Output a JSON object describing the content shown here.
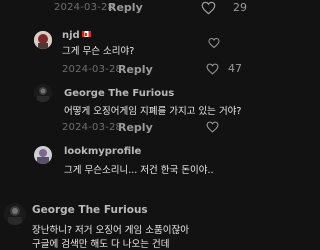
{
  "top_comment": {
    "date": "2024-03-28",
    "reply_label": "Reply",
    "like_count": "29"
  },
  "replies": [
    {
      "username": "njd",
      "flag": "canada-flag-icon",
      "text": "그게 무슨 소리야?",
      "date": "2024-03-28",
      "reply_label": "Reply",
      "like_count": "47"
    },
    {
      "username": "George The Furious",
      "text": "어떻게 오징어게임 지폐를 가지고 있는 거야?",
      "date": "2024-03-28",
      "reply_label": "Reply",
      "like_count": ""
    },
    {
      "username": "lookmyprofile",
      "text": "그게 무슨소리니... 저건 한국 돈이야.."
    }
  ],
  "main_comment": {
    "username": "George The Furious",
    "text_lines": [
      "장난하니? 저거 오징어 게임 소품이잖아",
      "구글에 검색만 해도 다 나오는 건데"
    ]
  },
  "colors": {
    "background": "#121212",
    "username": "#b9b9b9",
    "timestamp": "#6f6f6f"
  }
}
